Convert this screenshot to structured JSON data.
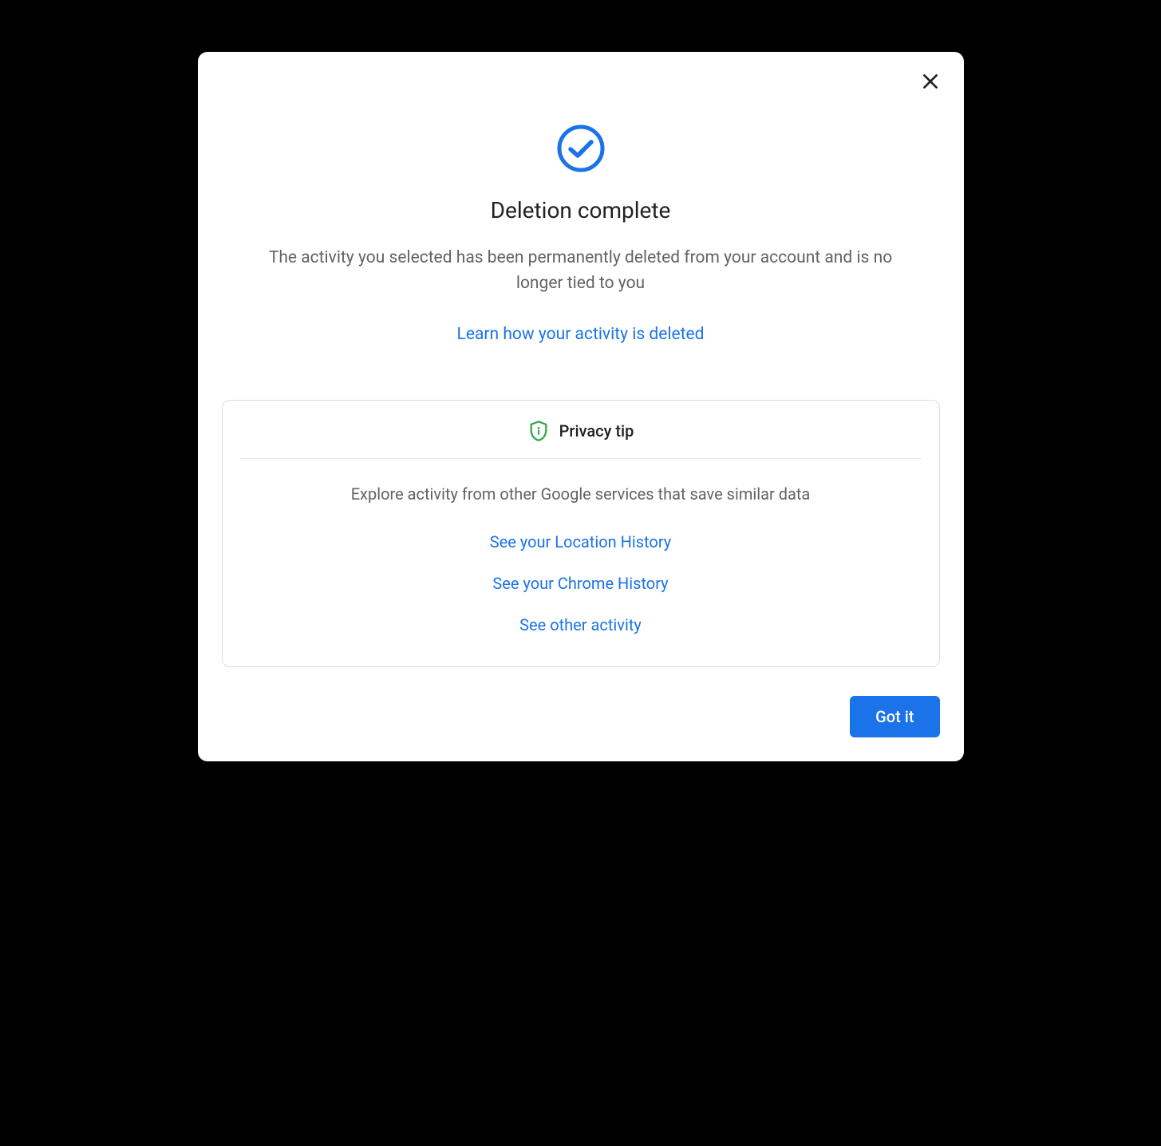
{
  "dialog": {
    "title": "Deletion complete",
    "description": "The activity you selected has been permanently deleted from your account and is no longer tied to you",
    "learn_link": "Learn how your activity is deleted"
  },
  "tip": {
    "title": "Privacy tip",
    "description": "Explore activity from other Google services that save similar data",
    "links": {
      "location": "See your Location History",
      "chrome": "See your Chrome History",
      "other": "See other activity"
    }
  },
  "footer": {
    "confirm_label": "Got it"
  }
}
